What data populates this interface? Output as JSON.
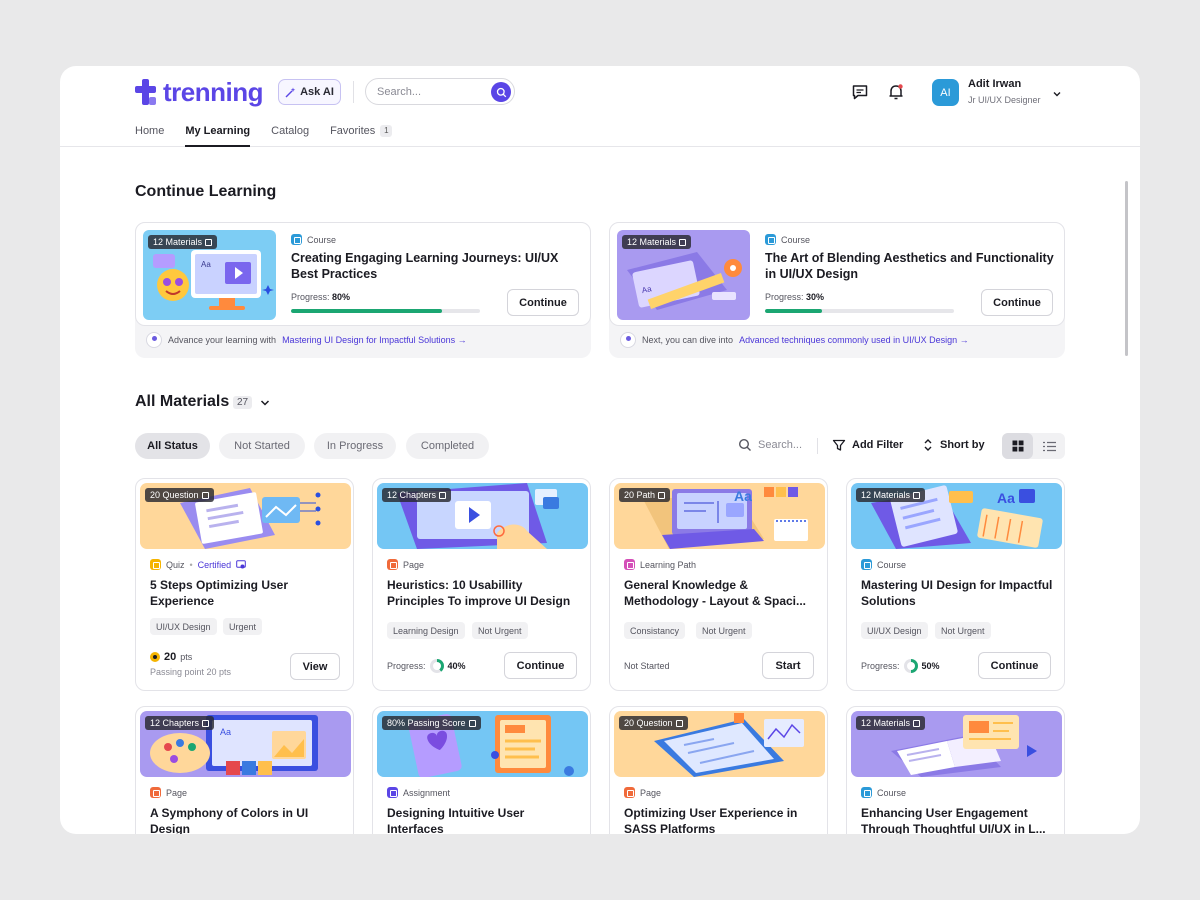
{
  "app": {
    "logo_text": "trenning",
    "ask_ai": "Ask AI"
  },
  "search": {
    "placeholder": "Search..."
  },
  "user": {
    "initials": "AI",
    "name": "Adit Irwan",
    "role": "Jr UI/UX Designer"
  },
  "nav": {
    "items": [
      {
        "label": "Home"
      },
      {
        "label": "My Learning",
        "active": true
      },
      {
        "label": "Catalog"
      },
      {
        "label": "Favorites",
        "badge": "1"
      }
    ]
  },
  "continue_learning": {
    "title": "Continue Learning",
    "cards": [
      {
        "badge": "12 Materials",
        "type": "Course",
        "title": "Creating Engaging Learning Journeys: UI/UX Best Practices",
        "progress_label": "Progress:",
        "progress": "80%",
        "progress_value": 0.8,
        "button": "Continue",
        "footer_prefix": "Advance your learning with",
        "footer_link": "Mastering UI Design for Impactful Solutions →"
      },
      {
        "badge": "12 Materials",
        "type": "Course",
        "title": "The Art of Blending Aesthetics and Functionality in UI/UX Design",
        "progress_label": "Progress:",
        "progress": "30%",
        "progress_value": 0.3,
        "button": "Continue",
        "footer_prefix": "Next, you can dive into",
        "footer_link": "Advanced techniques commonly used in UI/UX Design →"
      }
    ]
  },
  "all_materials": {
    "title": "All Materials",
    "count": "27",
    "filters": [
      "All Status",
      "Not Started",
      "In Progress",
      "Completed"
    ],
    "active_filter": "All Status",
    "search_placeholder": "Search...",
    "add_filter": "Add Filter",
    "sort": "Short by",
    "cards": [
      {
        "badge": "20 Question",
        "type": "Quiz",
        "certified": "Certified",
        "title": "5 Steps Optimizing User Experience",
        "tags": [
          "UI/UX Design",
          "Urgent"
        ],
        "points": "20",
        "points_unit": "pts",
        "points_sub": "Passing point 20 pts",
        "button": "View"
      },
      {
        "badge": "12 Chapters",
        "type": "Page",
        "title": "Heuristics: 10 Usabillity Principles To improve UI Design",
        "tags": [
          "Learning Design",
          "Not Urgent"
        ],
        "progress_label": "Progress:",
        "progress": "40%",
        "progress_value": 0.4,
        "button": "Continue"
      },
      {
        "badge": "20 Path",
        "type": "Learning Path",
        "title": "General Knowledge & Methodology - Layout & Spaci...",
        "tags": [
          "Consistancy",
          "Not Urgent"
        ],
        "status": "Not Started",
        "button": "Start"
      },
      {
        "badge": "12 Materials",
        "type": "Course",
        "title": "Mastering UI Design for Impactful Solutions",
        "tags": [
          "UI/UX Design",
          "Not Urgent"
        ],
        "progress_label": "Progress:",
        "progress": "50%",
        "progress_value": 0.5,
        "button": "Continue"
      },
      {
        "badge": "12 Chapters",
        "type": "Page",
        "title": "A Symphony of Colors in UI Design"
      },
      {
        "badge": "80% Passing Score",
        "type": "Assignment",
        "title": "Designing Intuitive User Interfaces"
      },
      {
        "badge": "20 Question",
        "type": "Page",
        "title": "Optimizing User Experience in SASS Platforms"
      },
      {
        "badge": "12 Materials",
        "type": "Course",
        "title": "Enhancing User Engagement Through Thoughtful UI/UX in L..."
      }
    ]
  },
  "colors": {
    "brand": "#5b46e6",
    "progress": "#1ba672",
    "link": "#4a36d8"
  }
}
